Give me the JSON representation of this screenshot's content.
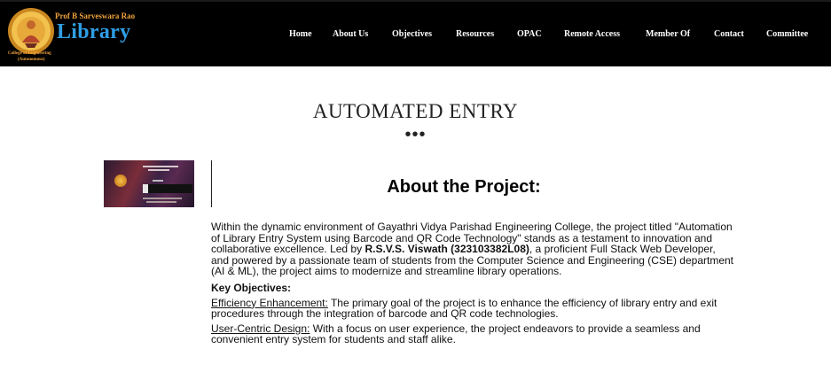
{
  "header": {
    "logo_top": "Prof B Sarveswara Rao",
    "logo_word": "Library",
    "logo_sub1": "College of Engineering",
    "logo_sub2": "(Autonomous)",
    "nav": [
      {
        "label": "Home"
      },
      {
        "label": "About Us"
      },
      {
        "label": "Objectives"
      },
      {
        "label": "Resources"
      },
      {
        "label": "OPAC"
      },
      {
        "label": "Remote Access"
      },
      {
        "label": "Member Of"
      },
      {
        "label": "Contact"
      },
      {
        "label": "Committee"
      }
    ]
  },
  "page": {
    "title": "AUTOMATED ENTRY",
    "dots": "•••"
  },
  "about": {
    "heading": "About the Project:",
    "intro_before": "Within the dynamic environment of Gayathri Vidya Parishad Engineering College, the project titled \"Automation of Library Entry System using Barcode and QR Code Technology\" stands as a testament to innovation and collaborative excellence. Led by ",
    "lead_name": "R.S.V.S. Viswath (323103382L08)",
    "intro_after": ", a proficient Full Stack Web Developer, and powered by a passionate team of students from the Computer Science and Engineering (CSE) department (AI & ML), the project aims to modernize and streamline library operations.",
    "objectives_heading": "Key Objectives:",
    "objectives": [
      {
        "term": "Efficiency Enhancement:",
        "text": " The primary goal of the project is to enhance the efficiency of library entry and exit procedures through the integration of barcode and QR code technologies."
      },
      {
        "term": "User-Centric Design:",
        "text": " With a focus on user experience, the project endeavors to provide a seamless and convenient entry system for students and staff alike."
      }
    ]
  },
  "colors": {
    "header_bg": "#000000",
    "logo_word": "#2f9ee6",
    "logo_accent": "#f0a33a"
  }
}
